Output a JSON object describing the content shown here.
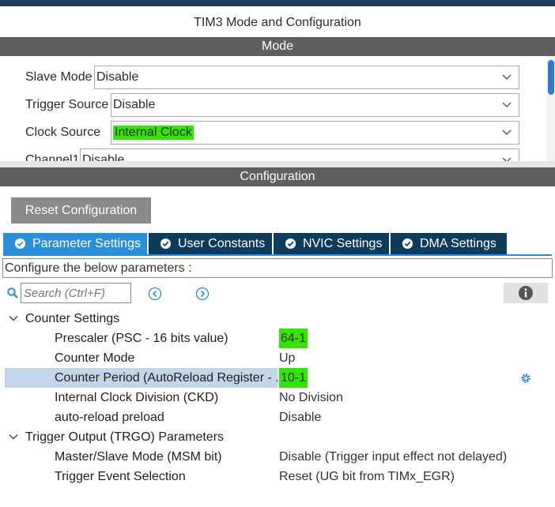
{
  "window": {
    "title": "TIM3 Mode and Configuration"
  },
  "mode": {
    "section_label": "Mode",
    "fields": [
      {
        "label": "Slave Mode",
        "value": "Disable"
      },
      {
        "label": "Trigger Source",
        "value": "Disable"
      },
      {
        "label": "Clock Source",
        "value": "Internal Clock"
      },
      {
        "label": "Channel1",
        "value": "Disable"
      }
    ]
  },
  "configuration": {
    "section_label": "Configuration",
    "reset_button": "Reset Configuration",
    "tabs": [
      {
        "label": "Parameter Settings",
        "active": true
      },
      {
        "label": "User Constants",
        "active": false
      },
      {
        "label": "NVIC Settings",
        "active": false
      },
      {
        "label": "DMA Settings",
        "active": false
      }
    ],
    "description": "Configure the below parameters :",
    "search": {
      "placeholder": "Search (Ctrl+F)"
    },
    "tree": {
      "groups": [
        {
          "label": "Counter Settings",
          "params": [
            {
              "label": "Prescaler (PSC - 16 bits value)",
              "value": "64-1"
            },
            {
              "label": "Counter Mode",
              "value": "Up"
            },
            {
              "label": "Counter Period (AutoReload Register - ..",
              "value": "10-1"
            },
            {
              "label": "Internal Clock Division (CKD)",
              "value": "No Division"
            },
            {
              "label": "auto-reload preload",
              "value": "Disable"
            }
          ]
        },
        {
          "label": "Trigger Output (TRGO) Parameters",
          "params": [
            {
              "label": "Master/Slave Mode (MSM bit)",
              "value": "Disable (Trigger input effect not delayed)"
            },
            {
              "label": "Trigger Event Selection",
              "value": "Reset (UG bit from TIMx_EGR)"
            }
          ]
        }
      ]
    }
  },
  "colors": {
    "highlight": "#33e600",
    "tab_active": "#2b8ed8",
    "tab_inactive": "#0f3b5c",
    "section_bar": "#5f5f5f",
    "selected_row": "#c2d6ea"
  }
}
